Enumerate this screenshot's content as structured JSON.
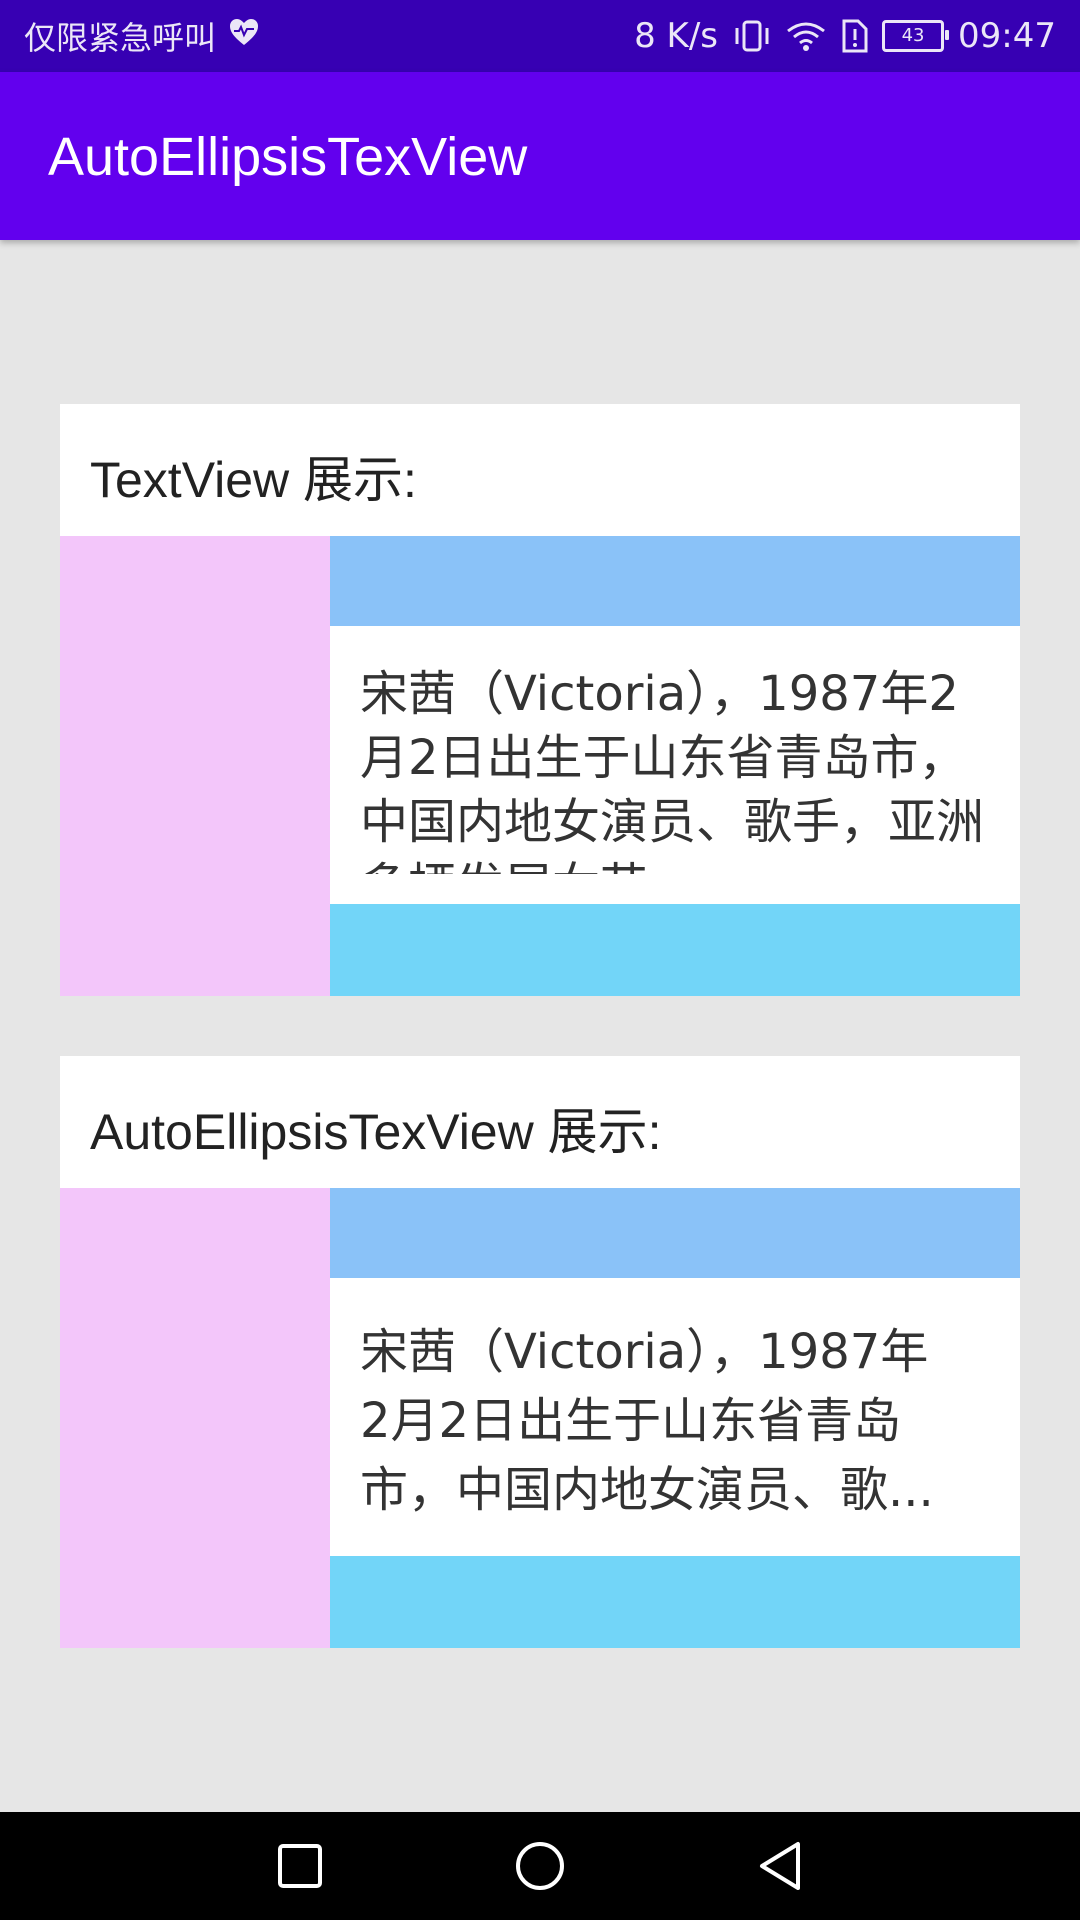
{
  "status_bar": {
    "left_text": "仅限紧急呼叫",
    "speed": "8 K/s",
    "battery": "43",
    "time": "09:47",
    "icons": [
      "heart-pulse-icon",
      "vibrate-icon",
      "wifi-icon",
      "sim-alert-icon",
      "battery-icon"
    ]
  },
  "app_bar": {
    "title": "AutoEllipsisTexView"
  },
  "card1": {
    "label": "TextView 展示:",
    "text": "宋茜（Victoria），1987年2月2日出生于山东省青岛市，中国内地女演员、歌手，亚洲多栖发展女艺"
  },
  "card2": {
    "label": "AutoEllipsisTexView 展示:",
    "line1": "宋茜（Victoria），1987年",
    "line2": "2月2日出生于山东省青岛",
    "line3": "市，中国内地女演员、歌..."
  },
  "colors": {
    "status_bar": "#3700b3",
    "app_bar": "#6200ee",
    "background": "#e6e6e6",
    "pink": "#f3c6fa",
    "blue_top": "#8ac2f8",
    "blue_bottom": "#72d5f8"
  },
  "nav_bar": {
    "icons": [
      "recents-square-icon",
      "home-circle-icon",
      "back-triangle-icon"
    ]
  }
}
